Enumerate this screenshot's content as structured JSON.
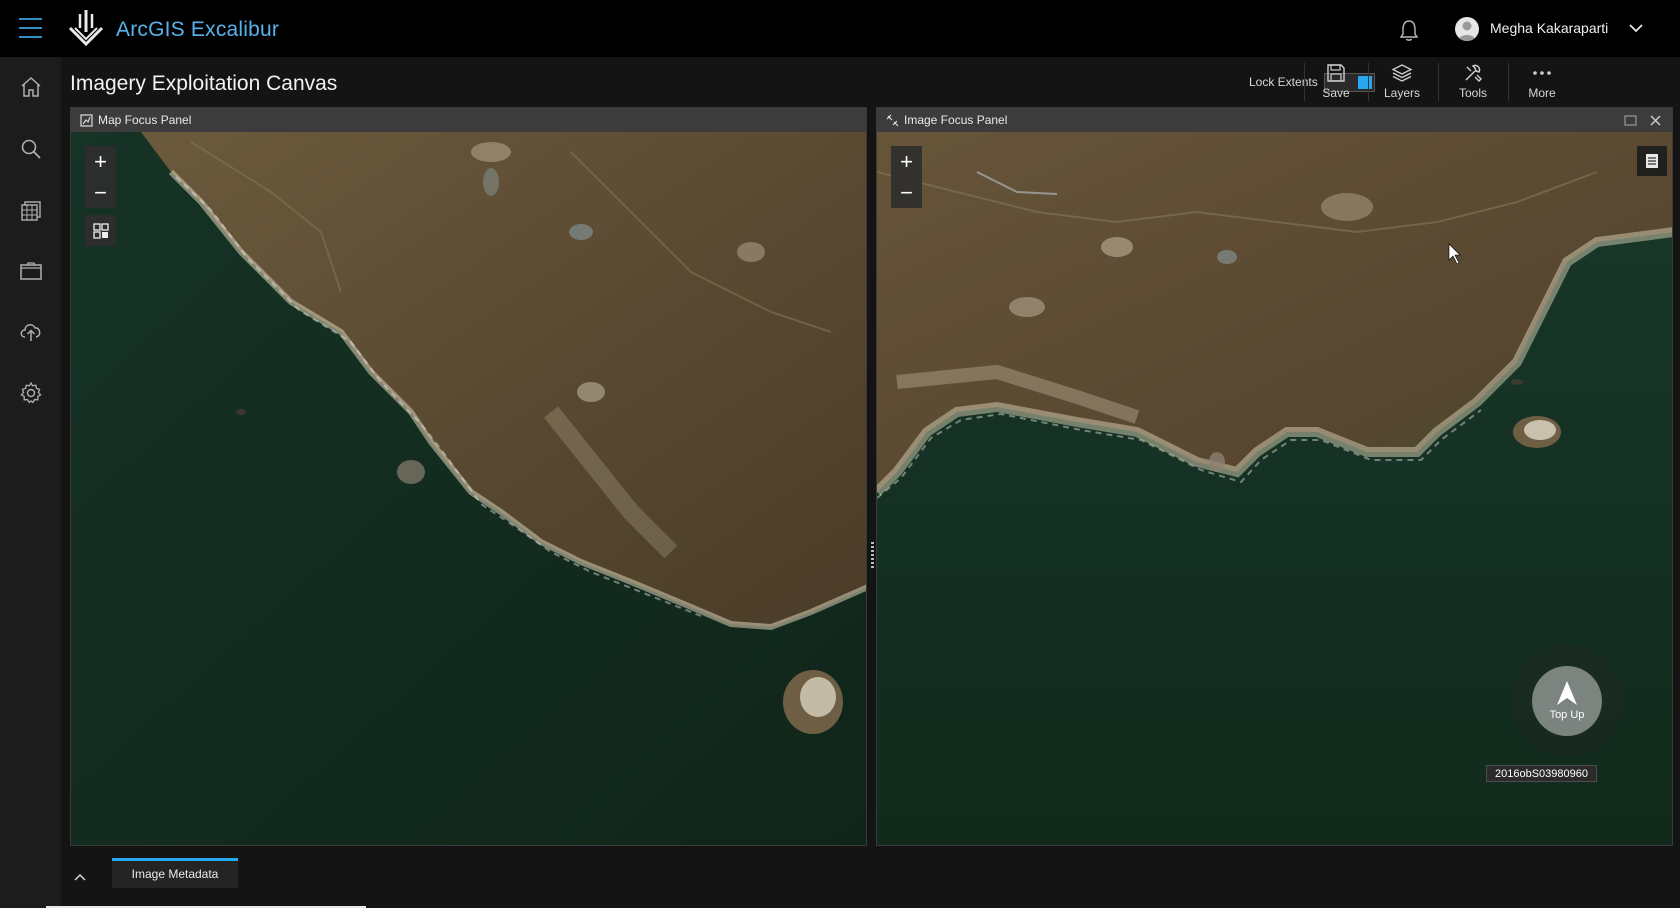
{
  "header": {
    "app_title": "ArcGIS Excalibur",
    "user_name": "Megha Kakaraparti"
  },
  "rail": {
    "items": [
      "home",
      "search",
      "imagery-catalog",
      "projects",
      "upload",
      "settings"
    ]
  },
  "page": {
    "title": "Imagery Exploitation Canvas"
  },
  "toolbar": {
    "lock_extents_label": "Lock Extents",
    "lock_extents_on": true,
    "save_label": "Save",
    "layers_label": "Layers",
    "tools_label": "Tools",
    "more_label": "More"
  },
  "panels": {
    "map_focus": {
      "title": "Map Focus Panel"
    },
    "image_focus": {
      "title": "Image Focus Panel",
      "north_label": "Top Up",
      "image_id": "2016obS03980960"
    }
  },
  "bottom": {
    "metadata_tab": "Image Metadata"
  },
  "icons": {
    "menu": "hamburger-icon",
    "notifications": "bell-icon",
    "user_menu": "chevron-down-icon"
  },
  "colors": {
    "accent": "#27a9f0",
    "brand_text": "#58b3ec",
    "water": "#13291f",
    "land": "#5d4d33"
  }
}
